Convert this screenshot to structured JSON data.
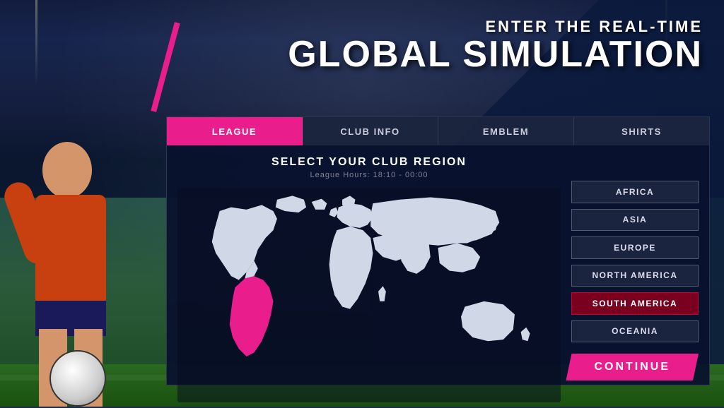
{
  "title": {
    "subtitle": "ENTER THE REAL-TIME",
    "main": "GLOBAL SIMULATION"
  },
  "tabs": [
    {
      "id": "league",
      "label": "LEAGUE",
      "active": true
    },
    {
      "id": "club-info",
      "label": "CLUB INFO",
      "active": false
    },
    {
      "id": "emblem",
      "label": "EMBLEM",
      "active": false
    },
    {
      "id": "shirts",
      "label": "SHIRTS",
      "active": false
    }
  ],
  "panel": {
    "map_title": "SELECT YOUR CLUB REGION",
    "map_subtitle": "League Hours: 18:10 - 00:00"
  },
  "regions": [
    {
      "id": "africa",
      "label": "AFRICA",
      "selected": false
    },
    {
      "id": "asia",
      "label": "ASIA",
      "selected": false
    },
    {
      "id": "europe",
      "label": "EUROPE",
      "selected": false
    },
    {
      "id": "north-america",
      "label": "NORTH AMERICA",
      "selected": false
    },
    {
      "id": "south-america",
      "label": "SOUTH AMERICA",
      "selected": true
    },
    {
      "id": "oceania",
      "label": "OCEANIA",
      "selected": false
    }
  ],
  "continue_btn": "CONTINUE"
}
